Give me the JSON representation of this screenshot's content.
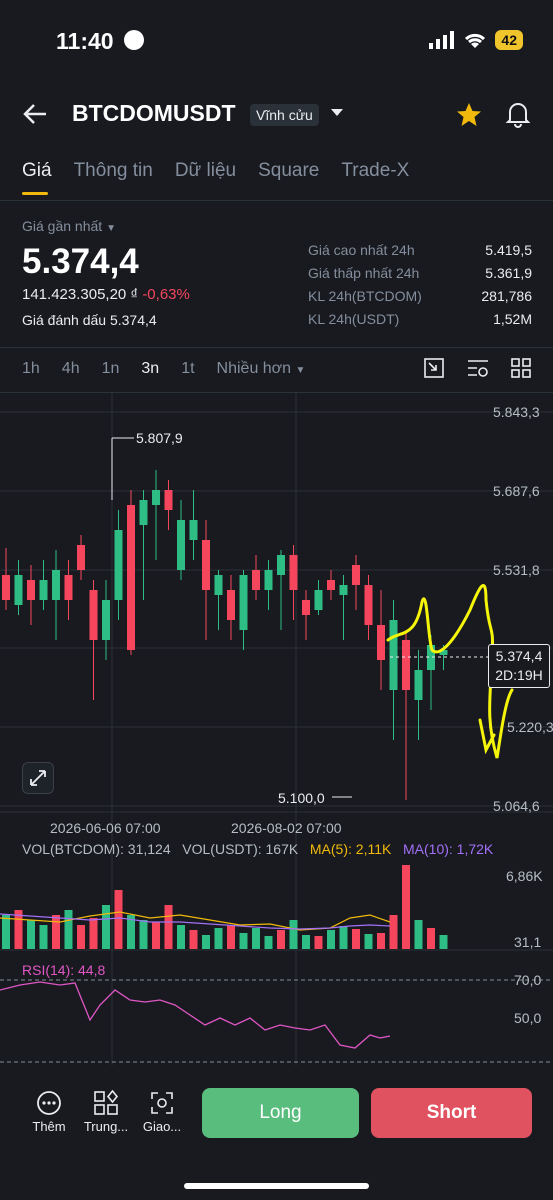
{
  "status": {
    "time": "11:40",
    "battery": "42"
  },
  "header": {
    "symbol": "BTCDOMUSDT",
    "contract_type": "Vĩnh cửu"
  },
  "tabs": [
    "Giá",
    "Thông tin",
    "Dữ liệu",
    "Square",
    "Trade-X"
  ],
  "ticker": {
    "last_price_label": "Giá gần nhất",
    "last_price": "5.374,4",
    "vnd_value": "141.423.305,20 ₫",
    "change": "-0,63%",
    "mark_price_label": "Giá đánh dấu",
    "mark_price": "5.374,4",
    "stats": [
      {
        "label": "Giá cao nhất 24h",
        "value": "5.419,5"
      },
      {
        "label": "Giá thấp nhất 24h",
        "value": "5.361,9"
      },
      {
        "label": "KL 24h(BTCDOM)",
        "value": "281,786"
      },
      {
        "label": "KL 24h(USDT)",
        "value": "1,52M"
      }
    ]
  },
  "intervals": [
    "1h",
    "4h",
    "1n",
    "3n",
    "1t"
  ],
  "intervals_active": "3n",
  "more_label": "Nhiều hơn",
  "chart": {
    "price_axis": [
      "5.843,3",
      "5.687,6",
      "5.531,8",
      "5.374,4",
      "5.220,3",
      "5.064,6"
    ],
    "high_label": "5.807,9",
    "low_label": "5.100,0",
    "countdown": "2D:19H",
    "dates": [
      "2026-06-06 07:00",
      "2026-08-02 07:00"
    ],
    "vol_btcdom": "VOL(BTCDOM): 31,124",
    "vol_usdt": "VOL(USDT): 167K",
    "ma5": "MA(5): 2,11K",
    "ma10": "MA(10): 1,72K",
    "vol_axis_top": "6,86K",
    "vol_axis_bottom": "31,1",
    "rsi": "RSI(14): 44,8",
    "rsi_70": "70,0",
    "rsi_50": "50,0",
    "colors": {
      "up": "#2ebd85",
      "down": "#f6465d",
      "accent": "#f0b90b",
      "ma5": "#f0b90b",
      "ma10": "#a370f7",
      "rsi": "#e056c4"
    }
  },
  "bottom_nav": [
    "Thêm",
    "Trung...",
    "Giao..."
  ],
  "actions": {
    "long": "Long",
    "short": "Short"
  }
}
